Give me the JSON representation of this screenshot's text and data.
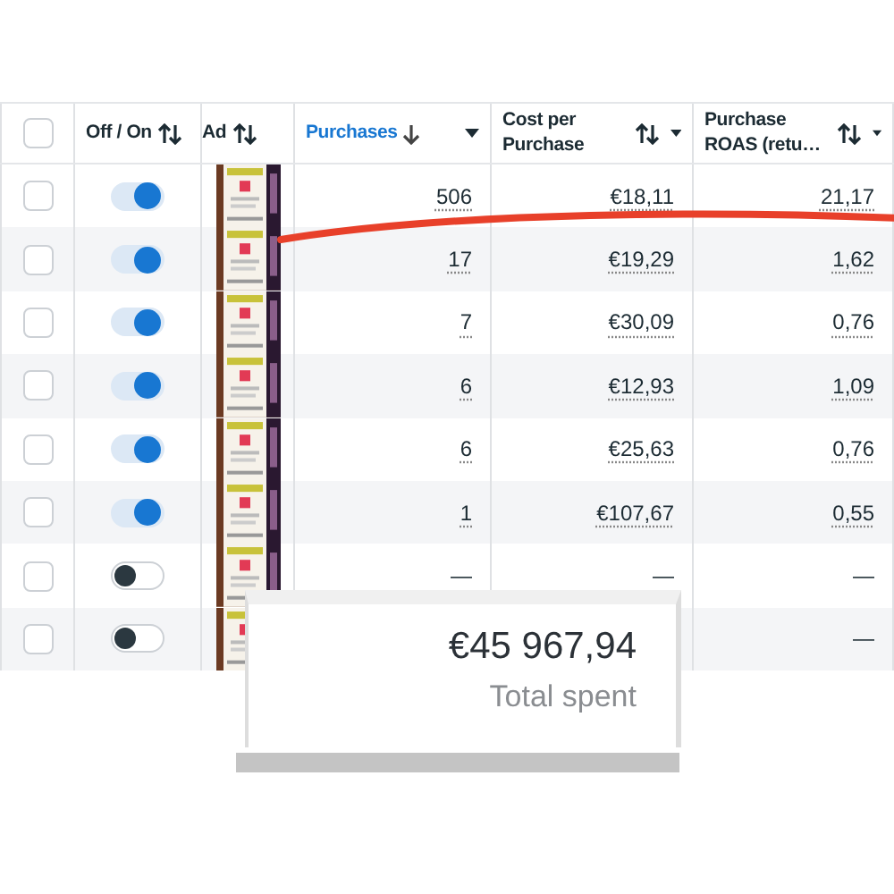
{
  "table": {
    "all_checked": false,
    "columns": [
      {
        "kind": "checkbox"
      },
      {
        "kind": "toggle",
        "label": "Off / On",
        "sorted": false
      },
      {
        "kind": "ad",
        "label": "Ad",
        "sorted": false
      },
      {
        "kind": "metric",
        "label": "Purchases",
        "sorted": true
      },
      {
        "kind": "metric",
        "label": "Cost per Purchase",
        "sorted": false
      },
      {
        "kind": "metric",
        "label": "Purchase ROAS (retu…",
        "sorted": false
      }
    ],
    "rows": [
      {
        "checked": false,
        "on": true,
        "cells": [
          "506",
          "€18,11",
          "21,17"
        ]
      },
      {
        "checked": false,
        "on": true,
        "cells": [
          "17",
          "€19,29",
          "1,62"
        ]
      },
      {
        "checked": false,
        "on": true,
        "cells": [
          "7",
          "€30,09",
          "0,76"
        ]
      },
      {
        "checked": false,
        "on": true,
        "cells": [
          "6",
          "€12,93",
          "1,09"
        ]
      },
      {
        "checked": false,
        "on": true,
        "cells": [
          "6",
          "€25,63",
          "0,76"
        ]
      },
      {
        "checked": false,
        "on": true,
        "cells": [
          "1",
          "€107,67",
          "0,55"
        ]
      },
      {
        "checked": false,
        "on": false,
        "cells": [
          "—",
          "—",
          "—"
        ]
      },
      {
        "checked": false,
        "on": false,
        "cells": [
          null,
          null,
          "—"
        ]
      }
    ]
  },
  "total": {
    "value": "€45 967,94",
    "label": "Total spent"
  }
}
